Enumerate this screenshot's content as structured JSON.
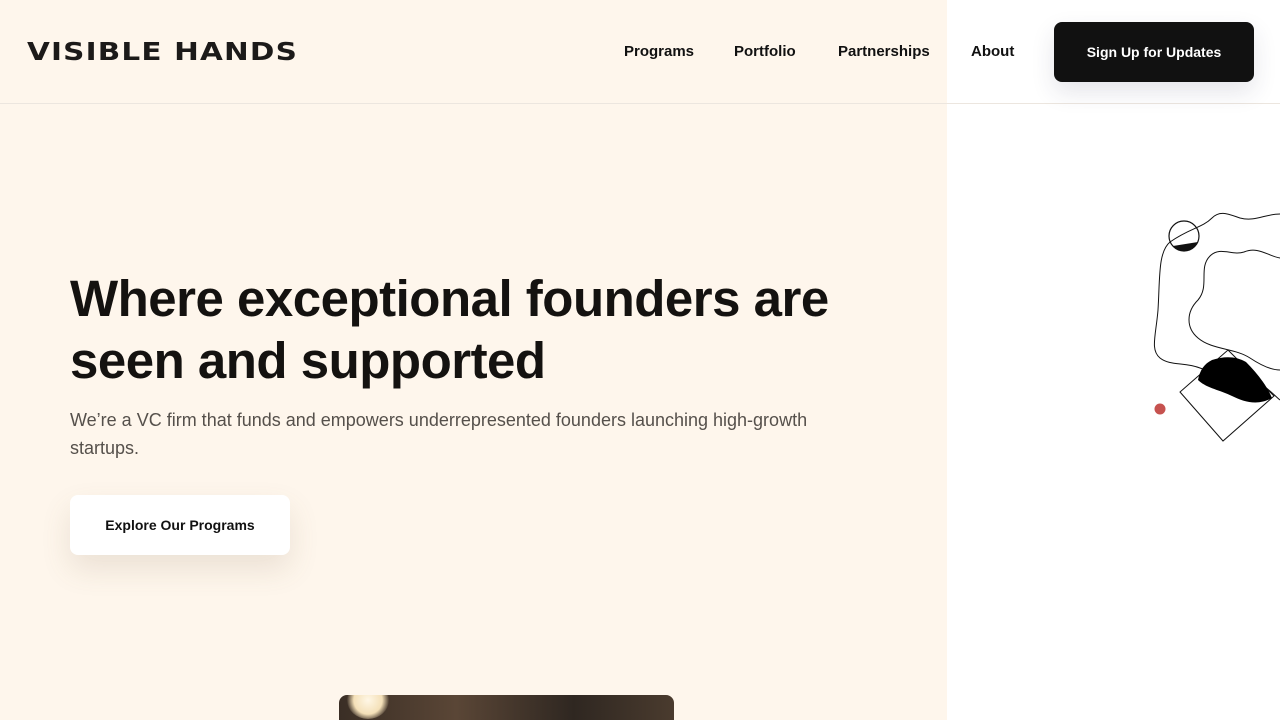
{
  "header": {
    "logo": "VISIBLE HANDS",
    "nav": [
      "Programs",
      "Portfolio",
      "Partnerships",
      "About"
    ],
    "cta_label": "Sign Up for Updates"
  },
  "hero": {
    "title": "Where exceptional founders are seen and supported",
    "subtitle": "We’re a VC firm that funds and empowers underrepresented founders launching high-growth startups.",
    "cta_label": "Explore Our Programs"
  },
  "colors": {
    "hero_background": "#fef6ec",
    "primary_button": "#111111",
    "accent_dot": "#c6524f"
  }
}
